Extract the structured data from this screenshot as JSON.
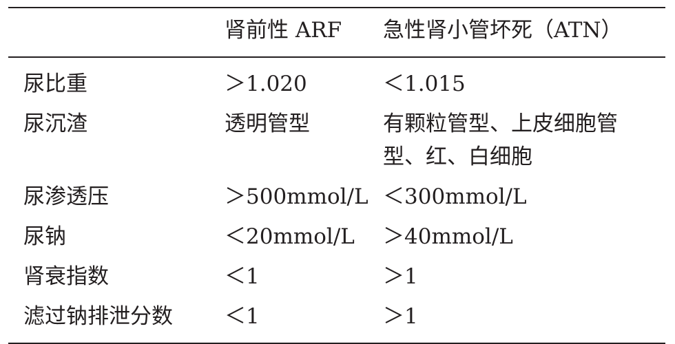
{
  "table": {
    "header": [
      "",
      "肾前性 ARF",
      "急性肾小管坏死（ATN）"
    ],
    "rows": [
      [
        "尿比重",
        "＞1.020",
        "＜1.015"
      ],
      [
        "尿沉渣",
        "透明管型",
        "有颗粒管型、上皮细胞管型、红、白细胞"
      ],
      [
        "尿渗透压",
        "＞500mmol/L",
        "＜300mmol/L"
      ],
      [
        "尿钠",
        "＜20mmol/L",
        "＞40mmol/L"
      ],
      [
        "肾衰指数",
        "＜1",
        "＞1"
      ],
      [
        "滤过钠排泄分数",
        "＜1",
        "＞1"
      ]
    ]
  }
}
